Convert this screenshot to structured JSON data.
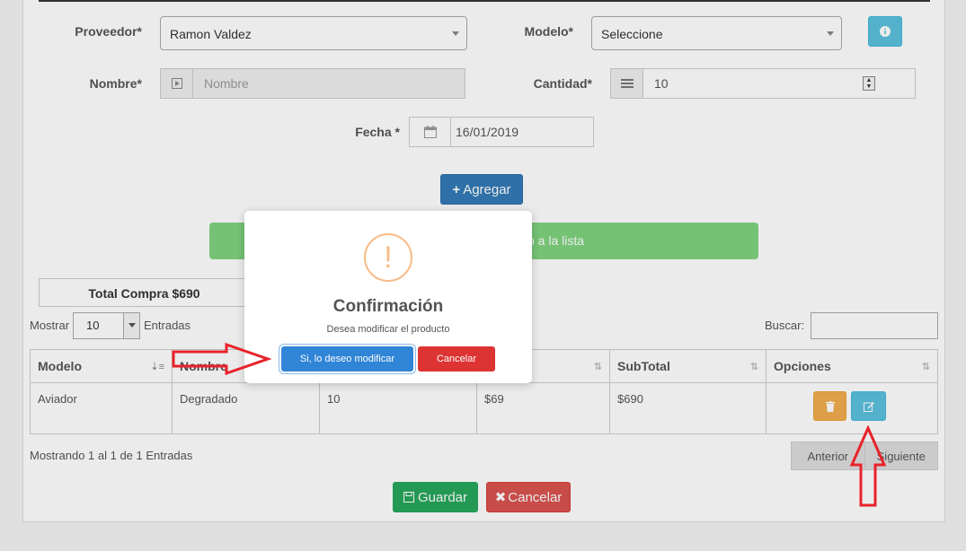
{
  "form": {
    "proveedor_label": "Proveedor*",
    "proveedor_value": "Ramon Valdez",
    "modelo_label": "Modelo*",
    "modelo_value": "Seleccione",
    "nombre_label": "Nombre*",
    "nombre_placeholder": "Nombre",
    "cantidad_label": "Cantidad*",
    "cantidad_value": "10",
    "fecha_label": "Fecha *",
    "fecha_value": "16/01/2019",
    "agregar_label": "Agregar"
  },
  "alert": {
    "text": "o a la lista"
  },
  "total": {
    "text": "Total Compra $690"
  },
  "table_controls": {
    "mostrar": "Mostrar",
    "length_value": "10",
    "entradas": "Entradas",
    "buscar": "Buscar:"
  },
  "table": {
    "headers": [
      "Modelo",
      "Nombre",
      "",
      "",
      "SubTotal",
      "Opciones"
    ],
    "rows": [
      [
        "Aviador",
        "Degradado",
        "10",
        "$69",
        "$690"
      ]
    ]
  },
  "footer": {
    "info": "Mostrando 1 al 1 de 1 Entradas",
    "anterior": "Anterior",
    "siguiente": "Siguiente",
    "guardar": "Guardar",
    "cancelar": "Cancelar"
  },
  "modal": {
    "icon": "!",
    "title": "Confirmación",
    "text": "Desea modificar el producto",
    "confirm_label": "Si, lo deseo modificar",
    "cancel_label": "Cancelar"
  },
  "colors": {
    "primary": "#337ab7",
    "success": "#5cb85c",
    "danger": "#d9534f",
    "warning": "#f0ad4e",
    "info": "#5bc0de",
    "annotation_arrow": "#e8232a"
  }
}
